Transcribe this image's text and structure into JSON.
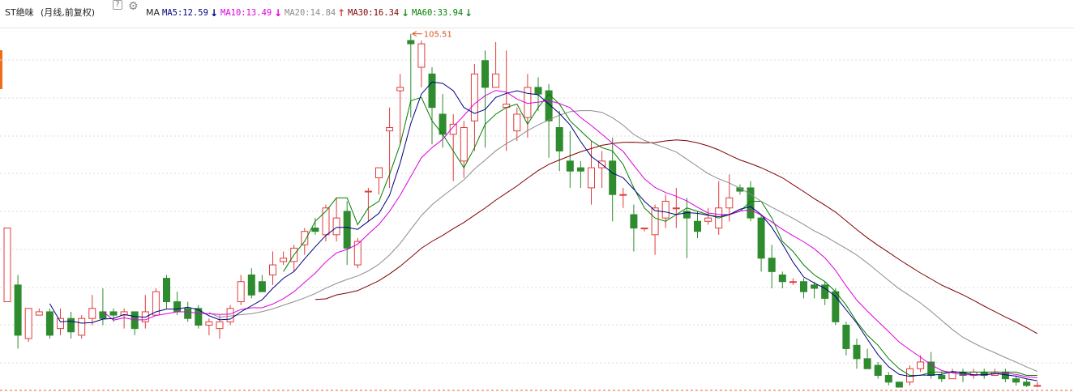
{
  "header": {
    "title": "ST绝味",
    "subtitle": "(月线,前复权)",
    "help_label": "?",
    "indicator_name": "MA",
    "ma5": {
      "label": "MA5:12.59",
      "arrow": "↓",
      "color": "#000080"
    },
    "ma10": {
      "label": "MA10:13.49",
      "arrow": "↓",
      "color": "#dd00dd"
    },
    "ma20": {
      "label": "MA20:14.84",
      "arrow": "↑",
      "color": "#8c8c8c"
    },
    "ma30": {
      "label": "MA30:16.34",
      "arrow": "↓",
      "color": "#800000"
    },
    "ma60": {
      "label": "MA60:33.94",
      "arrow": "↓",
      "color": "#008000"
    }
  },
  "colors": {
    "up": "#e03c3c",
    "down": "#2e8b2e",
    "marker": "#d9531e",
    "grid": "#dcdcdc",
    "baseline": "#e0643c",
    "tab": "#ef6c1a"
  },
  "chart_data": {
    "type": "candlestick",
    "period": "monthly",
    "adjustment": "forward-adjusted",
    "max_marker": {
      "label": "105.51",
      "value": 105.51
    },
    "price_range": [
      2.5,
      105.51
    ],
    "last_values": {
      "MA5": 12.59,
      "MA10": 13.49,
      "MA20": 14.84,
      "MA30": 16.34,
      "MA60": 33.94
    },
    "candles": [
      [
        28,
        28,
        50,
        50,
        30
      ],
      [
        26,
        33,
        18,
        14,
        36
      ],
      [
        27,
        17,
        26,
        16,
        24
      ],
      [
        26,
        24,
        25,
        24,
        26
      ],
      [
        28,
        25,
        18,
        17,
        26
      ],
      [
        29,
        20,
        23,
        18,
        26
      ],
      [
        27,
        23,
        19,
        17,
        25
      ],
      [
        28,
        18,
        23,
        17,
        24
      ],
      [
        26,
        23,
        26,
        21,
        30
      ],
      [
        23,
        25,
        23,
        21,
        32
      ],
      [
        23,
        25,
        24,
        22,
        26
      ],
      [
        24,
        24,
        25,
        20,
        26
      ],
      [
        24,
        25,
        20,
        18,
        25
      ],
      [
        25,
        22,
        25,
        20,
        30
      ],
      [
        25,
        24,
        31,
        24,
        32
      ],
      [
        26,
        35,
        28,
        26,
        36
      ],
      [
        25,
        28,
        25,
        24,
        31
      ],
      [
        25,
        26,
        23,
        22,
        28
      ],
      [
        26,
        26,
        21,
        20,
        27
      ],
      [
        26,
        21,
        22,
        18,
        23
      ],
      [
        25,
        20,
        22,
        17,
        24
      ],
      [
        24,
        22,
        26,
        21,
        27
      ],
      [
        23,
        28,
        34,
        27,
        36
      ],
      [
        24,
        36,
        30,
        29,
        38
      ],
      [
        28,
        34,
        31,
        31,
        36
      ],
      [
        32,
        36,
        39,
        33,
        43
      ],
      [
        37,
        40,
        41,
        39,
        43
      ],
      [
        42,
        40,
        44,
        37,
        45
      ],
      [
        46,
        45,
        49,
        42,
        50
      ],
      [
        52,
        50,
        49,
        48,
        53
      ],
      [
        55,
        48,
        56,
        46,
        57
      ],
      [
        59,
        48,
        53,
        46,
        59
      ],
      [
        59,
        55,
        44,
        39,
        58
      ],
      [
        51,
        39,
        46,
        38,
        47
      ],
      [
        56,
        61,
        61,
        52,
        62
      ],
      [
        58,
        65,
        68,
        60,
        68
      ],
      [
        66,
        79,
        80,
        62,
        86
      ],
      [
        75,
        91,
        92,
        75,
        96
      ],
      [
        88,
        106,
        105,
        83,
        108
      ],
      [
        89,
        98,
        105,
        92,
        106
      ],
      [
        82,
        96,
        86,
        75,
        98
      ],
      [
        78,
        84,
        78,
        74,
        90
      ],
      [
        73,
        78,
        81,
        64,
        84
      ],
      [
        68,
        70,
        80,
        65,
        82
      ],
      [
        74,
        82,
        96,
        73,
        99
      ],
      [
        81,
        100,
        92,
        74,
        103
      ],
      [
        84,
        92,
        96,
        92,
        105.51
      ],
      [
        86,
        86,
        87,
        73,
        103
      ],
      [
        87,
        79,
        84,
        76,
        86
      ],
      [
        81,
        83,
        92,
        77,
        96
      ],
      [
        86,
        92,
        90,
        85,
        95
      ],
      [
        90,
        91,
        82,
        71,
        93
      ],
      [
        87,
        80,
        73,
        67,
        85
      ],
      [
        82,
        70,
        67,
        62,
        79
      ],
      [
        79,
        68,
        67,
        62,
        70
      ],
      [
        76,
        62,
        68,
        57,
        76
      ],
      [
        74,
        68,
        70,
        62,
        73
      ],
      [
        73,
        70,
        60,
        52,
        77
      ],
      [
        69,
        60,
        60,
        56,
        62
      ],
      [
        62,
        54,
        50,
        43,
        57
      ],
      [
        56,
        50,
        50,
        49,
        50
      ],
      [
        53,
        48,
        56,
        42,
        57
      ],
      [
        52,
        53,
        58,
        50,
        60
      ],
      [
        54,
        56,
        56,
        50,
        62
      ],
      [
        56,
        55,
        53,
        41,
        59
      ],
      [
        55,
        52,
        49,
        47,
        55
      ],
      [
        54,
        52,
        53,
        51,
        56
      ],
      [
        53,
        50,
        56,
        48,
        64
      ],
      [
        54,
        56,
        59,
        52,
        66
      ],
      [
        55,
        62,
        61,
        60,
        63
      ],
      [
        58,
        62,
        53,
        52,
        64
      ],
      [
        58,
        53,
        41,
        37,
        54
      ],
      [
        53,
        41,
        37,
        32,
        45
      ],
      [
        46,
        36,
        34,
        32,
        37
      ],
      [
        43,
        34,
        34,
        33,
        35
      ],
      [
        39,
        34,
        31,
        29,
        35
      ],
      [
        36,
        33,
        32,
        29,
        34
      ],
      [
        34,
        33,
        29,
        27,
        34
      ],
      [
        31,
        31,
        22,
        21,
        32
      ],
      [
        27,
        21,
        14,
        12,
        22
      ],
      [
        22,
        15,
        11,
        8,
        17
      ],
      [
        18,
        11,
        8,
        8,
        14
      ],
      [
        15,
        9,
        6,
        5,
        10
      ],
      [
        11,
        6,
        4,
        3,
        7
      ],
      [
        8,
        4,
        2.5,
        2.5,
        4
      ],
      [
        6,
        4,
        8,
        3,
        9
      ],
      [
        6,
        8,
        10,
        7,
        12
      ],
      [
        7,
        10,
        6,
        5,
        13
      ],
      [
        7,
        6,
        5,
        4,
        7
      ],
      [
        7,
        5,
        7,
        5,
        8
      ],
      [
        7,
        7,
        6,
        4,
        8
      ],
      [
        7,
        6,
        7,
        5,
        8
      ],
      [
        7,
        7,
        6,
        5,
        8
      ],
      [
        7,
        6,
        7,
        6,
        8
      ],
      [
        7,
        7,
        5,
        4,
        8
      ],
      [
        7,
        5,
        4,
        3,
        6
      ],
      [
        6,
        4,
        3,
        2.5,
        5
      ],
      [
        6,
        3,
        3,
        2.5,
        4
      ]
    ],
    "candle_fields": [
      "ma60",
      "open",
      "close",
      "low",
      "high"
    ]
  }
}
